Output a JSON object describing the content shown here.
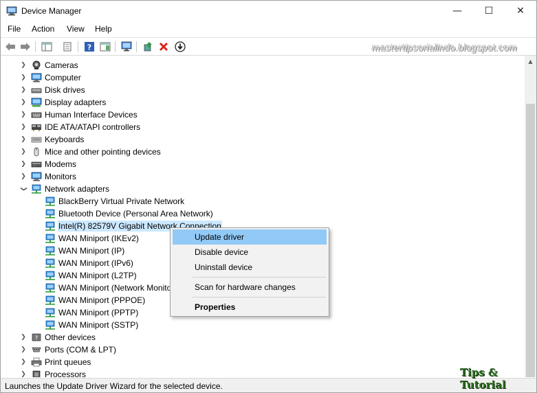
{
  "window": {
    "title": "Device Manager"
  },
  "title_buttons": {
    "minimize": "—",
    "maximize": "☐",
    "close": "✕"
  },
  "menu": [
    "File",
    "Action",
    "View",
    "Help"
  ],
  "watermark": "mastertipsorialindo.blogspot.com",
  "tree": {
    "items": [
      {
        "label": "Cameras",
        "icon": "camera-icon",
        "state": "collapsed"
      },
      {
        "label": "Computer",
        "icon": "computer-icon",
        "state": "collapsed"
      },
      {
        "label": "Disk drives",
        "icon": "disk-drive-icon",
        "state": "collapsed"
      },
      {
        "label": "Display adapters",
        "icon": "display-adapter-icon",
        "state": "collapsed"
      },
      {
        "label": "Human Interface Devices",
        "icon": "hid-icon",
        "state": "collapsed"
      },
      {
        "label": "IDE ATA/ATAPI controllers",
        "icon": "ide-controller-icon",
        "state": "collapsed"
      },
      {
        "label": "Keyboards",
        "icon": "keyboard-icon",
        "state": "collapsed"
      },
      {
        "label": "Mice and other pointing devices",
        "icon": "mouse-icon",
        "state": "collapsed"
      },
      {
        "label": "Modems",
        "icon": "modem-icon",
        "state": "collapsed"
      },
      {
        "label": "Monitors",
        "icon": "monitor-icon",
        "state": "collapsed"
      },
      {
        "label": "Network adapters",
        "icon": "network-adapter-icon",
        "state": "expanded"
      }
    ],
    "network_children": [
      "BlackBerry Virtual Private Network",
      "Bluetooth Device (Personal Area Network)",
      "Intel(R) 82579V Gigabit Network Connection",
      "WAN Miniport (IKEv2)",
      "WAN Miniport (IP)",
      "WAN Miniport (IPv6)",
      "WAN Miniport (L2TP)",
      "WAN Miniport (Network Monitor)",
      "WAN Miniport (PPPOE)",
      "WAN Miniport (PPTP)",
      "WAN Miniport (SSTP)"
    ],
    "selected_child": "Intel(R) 82579V Gigabit Network Connection",
    "after_items": [
      {
        "label": "Other devices",
        "icon": "other-devices-icon",
        "state": "collapsed"
      },
      {
        "label": "Ports (COM & LPT)",
        "icon": "ports-icon",
        "state": "collapsed"
      },
      {
        "label": "Print queues",
        "icon": "printer-icon",
        "state": "collapsed"
      },
      {
        "label": "Processors",
        "icon": "processor-icon",
        "state": "collapsed"
      }
    ]
  },
  "context_menu": {
    "update_driver": "Update driver",
    "disable_device": "Disable device",
    "uninstall_device": "Uninstall device",
    "scan_hardware": "Scan for hardware changes",
    "properties": "Properties"
  },
  "status": {
    "text": "Launches the Update Driver Wizard for the selected device.",
    "brand": "Tips & Tutorial"
  },
  "colors": {
    "selection": "#cce8ff",
    "menu_highlight": "#91c9f7",
    "network_icon": "#2c8ad8"
  }
}
